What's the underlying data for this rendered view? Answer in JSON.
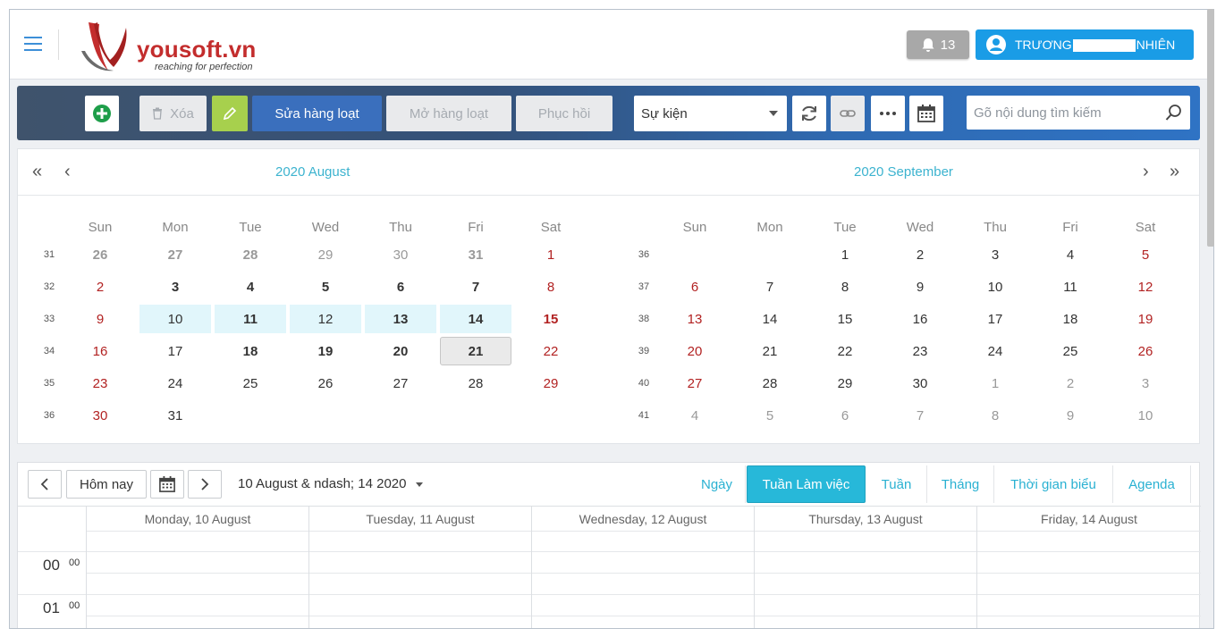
{
  "header": {
    "logo_text": "yousoft.vn",
    "logo_tagline": "reaching for perfection",
    "notifications": "13",
    "user_first": "TRƯƠNG",
    "user_last": "NHIÊN"
  },
  "toolbar": {
    "delete_label": "Xóa",
    "bulk_edit_label": "Sửa hàng loạt",
    "bulk_open_label": "Mở hàng loạt",
    "restore_label": "Phục hồi",
    "event_select": "Sự kiện",
    "search_placeholder": "Gõ nội dung tìm kiếm"
  },
  "mini_calendar": {
    "weekdays": [
      "Sun",
      "Mon",
      "Tue",
      "Wed",
      "Thu",
      "Fri",
      "Sat"
    ],
    "months": [
      {
        "title": "2020 August",
        "weeks": [
          {
            "wk": "31",
            "days": [
              {
                "d": "26",
                "s": "muted bold"
              },
              {
                "d": "27",
                "s": "muted bold"
              },
              {
                "d": "28",
                "s": "muted bold"
              },
              {
                "d": "29",
                "s": "muted"
              },
              {
                "d": "30",
                "s": "muted"
              },
              {
                "d": "31",
                "s": "muted bold"
              },
              {
                "d": "1",
                "s": "red"
              }
            ]
          },
          {
            "wk": "32",
            "days": [
              {
                "d": "2",
                "s": "red"
              },
              {
                "d": "3",
                "s": "bold"
              },
              {
                "d": "4",
                "s": "bold"
              },
              {
                "d": "5",
                "s": "bold"
              },
              {
                "d": "6",
                "s": "bold"
              },
              {
                "d": "7",
                "s": "bold"
              },
              {
                "d": "8",
                "s": "red"
              }
            ]
          },
          {
            "wk": "33",
            "days": [
              {
                "d": "9",
                "s": "red"
              },
              {
                "d": "10",
                "s": "hl"
              },
              {
                "d": "11",
                "s": "hl bold"
              },
              {
                "d": "12",
                "s": "hl"
              },
              {
                "d": "13",
                "s": "hl bold"
              },
              {
                "d": "14",
                "s": "hl bold"
              },
              {
                "d": "15",
                "s": "red bold"
              }
            ]
          },
          {
            "wk": "34",
            "days": [
              {
                "d": "16",
                "s": "red"
              },
              {
                "d": "17",
                "s": ""
              },
              {
                "d": "18",
                "s": "bold"
              },
              {
                "d": "19",
                "s": "bold"
              },
              {
                "d": "20",
                "s": "bold"
              },
              {
                "d": "21",
                "s": "today bold"
              },
              {
                "d": "22",
                "s": "red"
              }
            ]
          },
          {
            "wk": "35",
            "days": [
              {
                "d": "23",
                "s": "red"
              },
              {
                "d": "24",
                "s": ""
              },
              {
                "d": "25",
                "s": ""
              },
              {
                "d": "26",
                "s": ""
              },
              {
                "d": "27",
                "s": ""
              },
              {
                "d": "28",
                "s": ""
              },
              {
                "d": "29",
                "s": "red"
              }
            ]
          },
          {
            "wk": "36",
            "days": [
              {
                "d": "30",
                "s": "red"
              },
              {
                "d": "31",
                "s": ""
              },
              {
                "d": "",
                "s": ""
              },
              {
                "d": "",
                "s": ""
              },
              {
                "d": "",
                "s": ""
              },
              {
                "d": "",
                "s": ""
              },
              {
                "d": "",
                "s": ""
              }
            ]
          }
        ]
      },
      {
        "title": "2020 September",
        "weeks": [
          {
            "wk": "36",
            "days": [
              {
                "d": "",
                "s": ""
              },
              {
                "d": "",
                "s": ""
              },
              {
                "d": "1",
                "s": ""
              },
              {
                "d": "2",
                "s": ""
              },
              {
                "d": "3",
                "s": ""
              },
              {
                "d": "4",
                "s": ""
              },
              {
                "d": "5",
                "s": "red"
              }
            ]
          },
          {
            "wk": "37",
            "days": [
              {
                "d": "6",
                "s": "red"
              },
              {
                "d": "7",
                "s": ""
              },
              {
                "d": "8",
                "s": ""
              },
              {
                "d": "9",
                "s": ""
              },
              {
                "d": "10",
                "s": ""
              },
              {
                "d": "11",
                "s": ""
              },
              {
                "d": "12",
                "s": "red"
              }
            ]
          },
          {
            "wk": "38",
            "days": [
              {
                "d": "13",
                "s": "red"
              },
              {
                "d": "14",
                "s": ""
              },
              {
                "d": "15",
                "s": ""
              },
              {
                "d": "16",
                "s": ""
              },
              {
                "d": "17",
                "s": ""
              },
              {
                "d": "18",
                "s": ""
              },
              {
                "d": "19",
                "s": "red"
              }
            ]
          },
          {
            "wk": "39",
            "days": [
              {
                "d": "20",
                "s": "red"
              },
              {
                "d": "21",
                "s": ""
              },
              {
                "d": "22",
                "s": ""
              },
              {
                "d": "23",
                "s": ""
              },
              {
                "d": "24",
                "s": ""
              },
              {
                "d": "25",
                "s": ""
              },
              {
                "d": "26",
                "s": "red"
              }
            ]
          },
          {
            "wk": "40",
            "days": [
              {
                "d": "27",
                "s": "red"
              },
              {
                "d": "28",
                "s": ""
              },
              {
                "d": "29",
                "s": ""
              },
              {
                "d": "30",
                "s": ""
              },
              {
                "d": "1",
                "s": "muted"
              },
              {
                "d": "2",
                "s": "muted"
              },
              {
                "d": "3",
                "s": "muted"
              }
            ]
          },
          {
            "wk": "41",
            "days": [
              {
                "d": "4",
                "s": "muted"
              },
              {
                "d": "5",
                "s": "muted"
              },
              {
                "d": "6",
                "s": "muted"
              },
              {
                "d": "7",
                "s": "muted"
              },
              {
                "d": "8",
                "s": "muted"
              },
              {
                "d": "9",
                "s": "muted"
              },
              {
                "d": "10",
                "s": "muted"
              }
            ]
          }
        ]
      }
    ]
  },
  "scheduler": {
    "today_label": "Hôm nay",
    "range_label": "10 August & ndash; 14 2020",
    "views": [
      "Ngày",
      "Tuần Làm việc",
      "Tuần",
      "Tháng",
      "Thời gian biểu",
      "Agenda"
    ],
    "active_view": "Tuần Làm việc",
    "columns": [
      "Monday, 10 August",
      "Tuesday, 11 August",
      "Wednesday, 12 August",
      "Thursday, 13 August",
      "Friday, 14 August"
    ],
    "hours": [
      {
        "h": "00",
        "m": "00"
      },
      {
        "h": "01",
        "m": "00"
      }
    ]
  },
  "colors": {
    "accent": "#27b8d9",
    "user_button": "#1a9ce6",
    "weekend_red": "#b22222",
    "month_title": "#3cb3cf"
  }
}
